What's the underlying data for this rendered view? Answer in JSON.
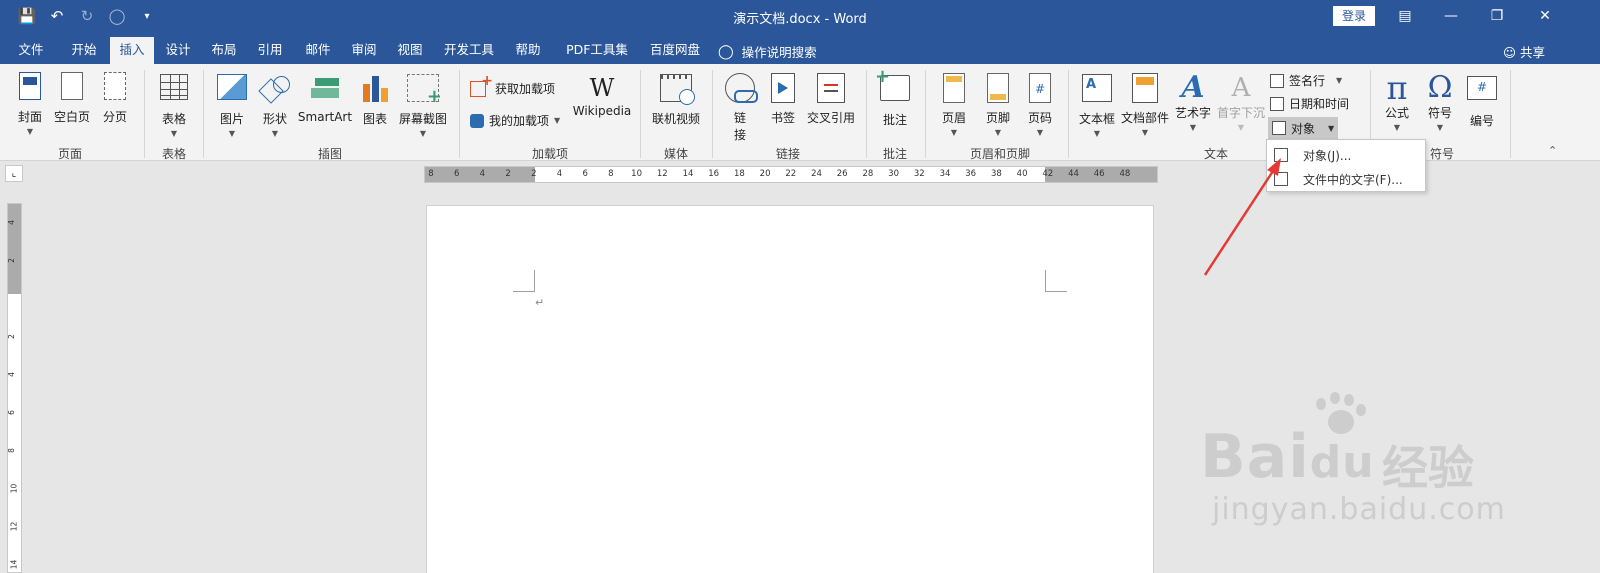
{
  "titlebar": {
    "title": "演示文档.docx  -  Word",
    "login": "登录",
    "qat_icons": [
      "save-icon",
      "undo-icon",
      "redo-icon",
      "circle-icon",
      "customize-icon"
    ]
  },
  "tabs": [
    {
      "label": "文件"
    },
    {
      "label": "开始"
    },
    {
      "label": "插入"
    },
    {
      "label": "设计"
    },
    {
      "label": "布局"
    },
    {
      "label": "引用"
    },
    {
      "label": "邮件"
    },
    {
      "label": "审阅"
    },
    {
      "label": "视图"
    },
    {
      "label": "开发工具"
    },
    {
      "label": "帮助"
    },
    {
      "label": "PDF工具集"
    },
    {
      "label": "百度网盘"
    }
  ],
  "active_tab": "插入",
  "tell_me": "操作说明搜索",
  "share": "共享",
  "ribbon": {
    "pages": {
      "cover": "封面",
      "blank": "空白页",
      "break": "分页",
      "group": "页面"
    },
    "tables": {
      "table": "表格",
      "group": "表格"
    },
    "illustrations": {
      "picture": "图片",
      "shapes": "形状",
      "smartart": "SmartArt",
      "chart": "图表",
      "screenshot": "屏幕截图",
      "group": "插图"
    },
    "addins": {
      "get": "获取加载项",
      "mine": "我的加载项",
      "wikipedia": "Wikipedia",
      "wiki_glyph": "W",
      "group": "加载项"
    },
    "media": {
      "video": "联机视频",
      "group": "媒体"
    },
    "links": {
      "link_top": "链",
      "link_bottom": "接",
      "bookmark": "书签",
      "xref": "交叉引用",
      "group": "链接"
    },
    "comments": {
      "comment": "批注",
      "group": "批注"
    },
    "header_footer": {
      "header": "页眉",
      "footer": "页脚",
      "page_number": "页码",
      "group": "页眉和页脚"
    },
    "text": {
      "textbox": "文本框",
      "quick_parts": "文档部件",
      "wordart": "艺术字",
      "dropcap": "首字下沉",
      "signature": "签名行",
      "datetime": "日期和时间",
      "object": "对象",
      "group": "文本"
    },
    "symbols": {
      "equation": "公式",
      "symbol": "符号",
      "numbering": "编号",
      "group": "符号"
    }
  },
  "dropdown": {
    "items": [
      {
        "label": "对象(J)..."
      },
      {
        "label": "文件中的文字(F)..."
      }
    ]
  },
  "ruler": {
    "h_numbers": [
      "8",
      "6",
      "4",
      "2",
      "2",
      "4",
      "6",
      "8",
      "10",
      "12",
      "14",
      "16",
      "18",
      "20",
      "22",
      "24",
      "26",
      "28",
      "30",
      "32",
      "34",
      "36",
      "38",
      "40",
      "42",
      "44",
      "46",
      "48"
    ],
    "v_numbers": [
      "4",
      "2",
      "2",
      "4",
      "6",
      "8",
      "10",
      "12",
      "14"
    ]
  },
  "page": {
    "paragraph_mark": "↵"
  },
  "watermark": {
    "brand": "Bai",
    "brand_tail": "du",
    "cn": "经验",
    "url": "jingyan.baidu.com"
  },
  "colors": {
    "accent": "#2b579a",
    "arrow": "#e53935"
  }
}
